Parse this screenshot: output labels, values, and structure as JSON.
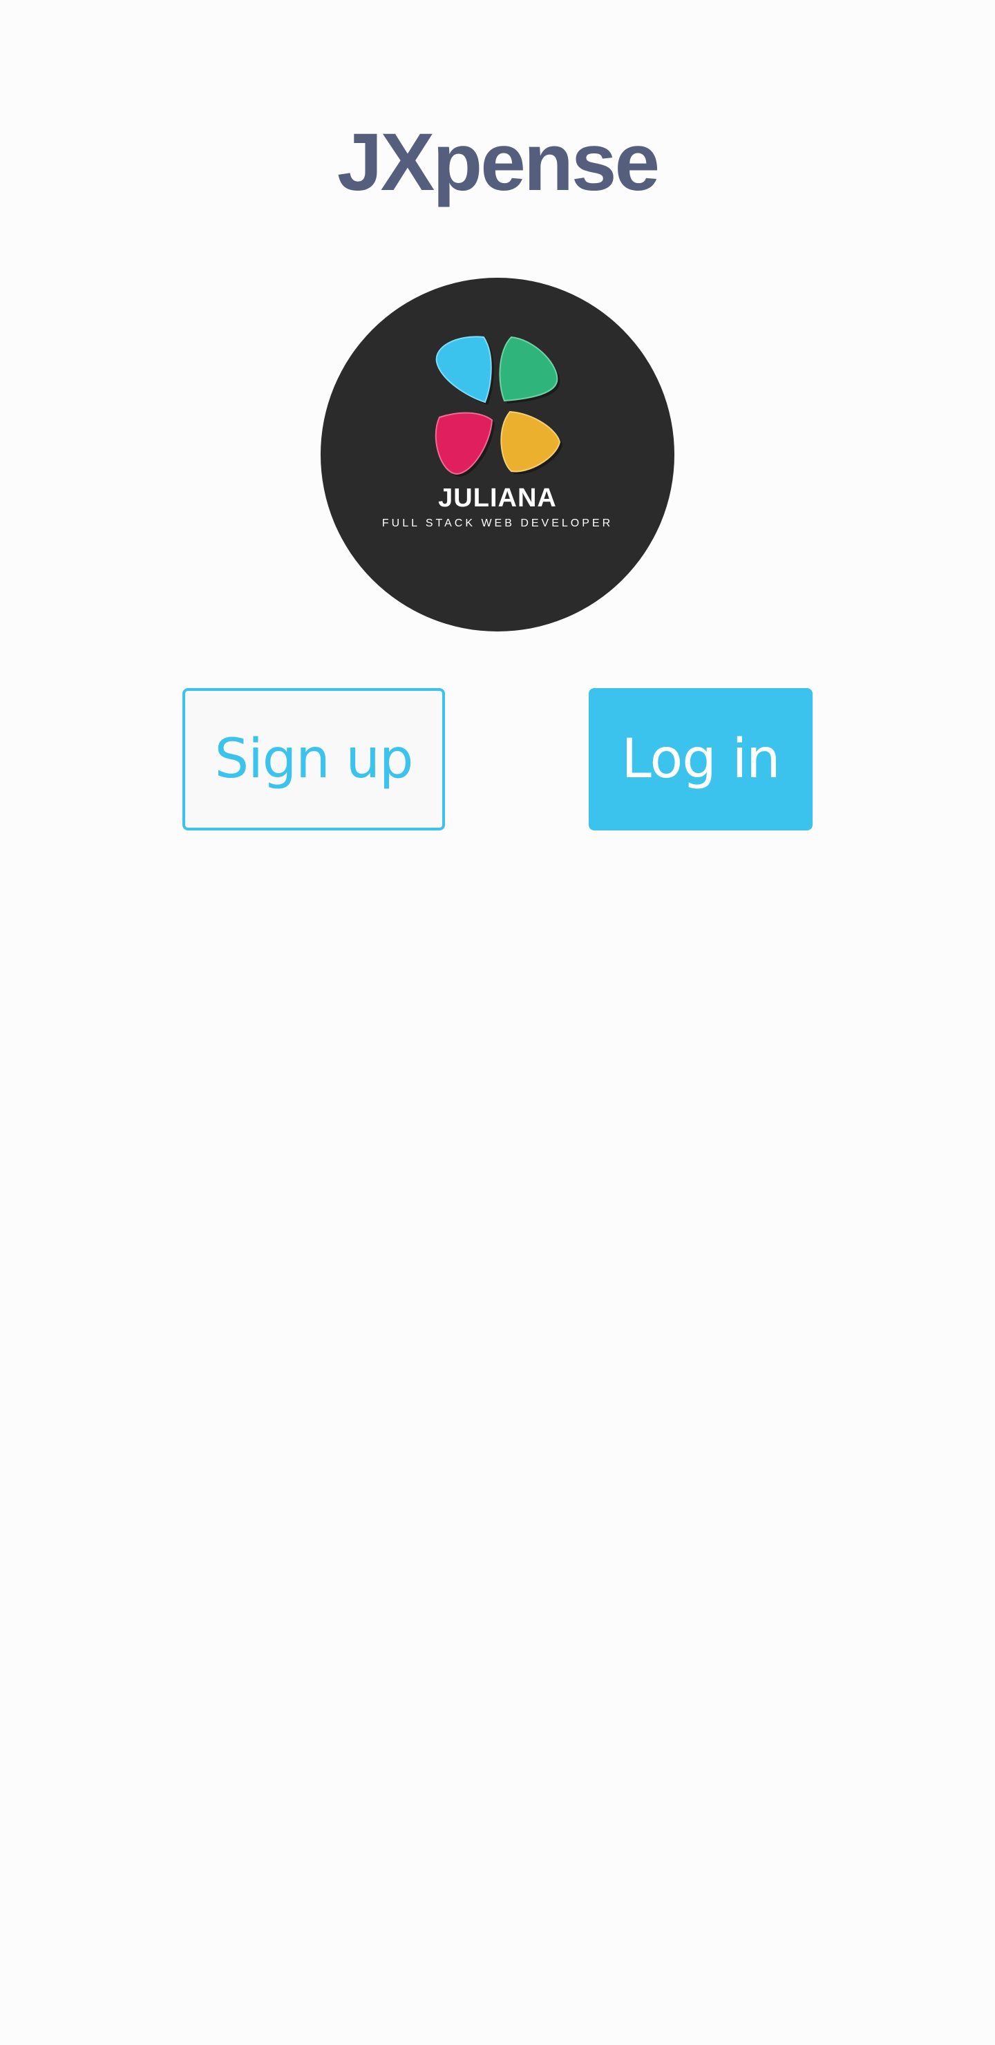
{
  "app": {
    "title": "JXpense"
  },
  "logo": {
    "name": "JULIANA",
    "tagline": "FULL STACK WEB DEVELOPER",
    "petal_colors": [
      "#3bc3ed",
      "#2fb57b",
      "#e01f5f",
      "#ecb02f"
    ],
    "background": "#2b2b2b"
  },
  "actions": {
    "signup_label": "Sign up",
    "login_label": "Log in"
  },
  "colors": {
    "accent": "#3bc3ed",
    "title": "#555f7d"
  }
}
